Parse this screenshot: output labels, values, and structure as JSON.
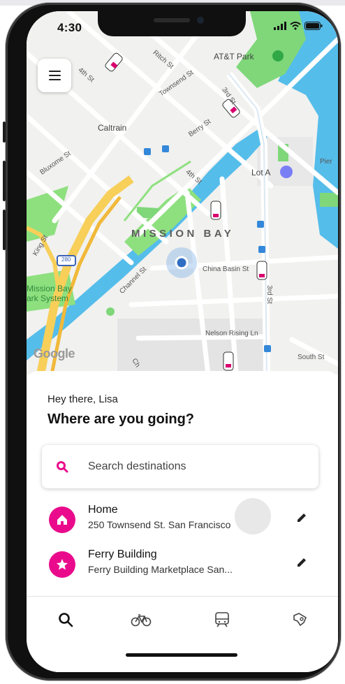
{
  "status_bar": {
    "time": "4:30"
  },
  "map": {
    "streets": [
      "4th St",
      "Ritch St",
      "Townsend St",
      "Berry St",
      "4th St",
      "Bluxome St",
      "King St",
      "Channel St",
      "China Basin St",
      "3rd St",
      "3rd St",
      "Nelson Rising Ln",
      "South St",
      "Pier",
      "Ch"
    ],
    "pois": [
      "AT&T Park",
      "Caltrain",
      "Lot A"
    ],
    "district": "MISSION BAY",
    "park": [
      "Mission Bay",
      "ark System"
    ],
    "highway_shield": "280",
    "attribution": "Google"
  },
  "sheet": {
    "greeting": "Hey there, Lisa",
    "question": "Where are you going?",
    "search_placeholder": "Search destinations",
    "saved_places": [
      {
        "title": "Home",
        "subtitle": "250 Townsend St. San Francisco",
        "icon": "home-icon"
      },
      {
        "title": "Ferry Building",
        "subtitle": "Ferry Building Marketplace San...",
        "icon": "star-icon"
      }
    ]
  },
  "bottom_nav": [
    "search-icon",
    "bike-icon",
    "transit-icon",
    "rent-icon"
  ],
  "colors": {
    "accent": "#ea0b8c",
    "water": "#55bdea",
    "park": "#7fd77a",
    "highway": "#f7cf59"
  }
}
